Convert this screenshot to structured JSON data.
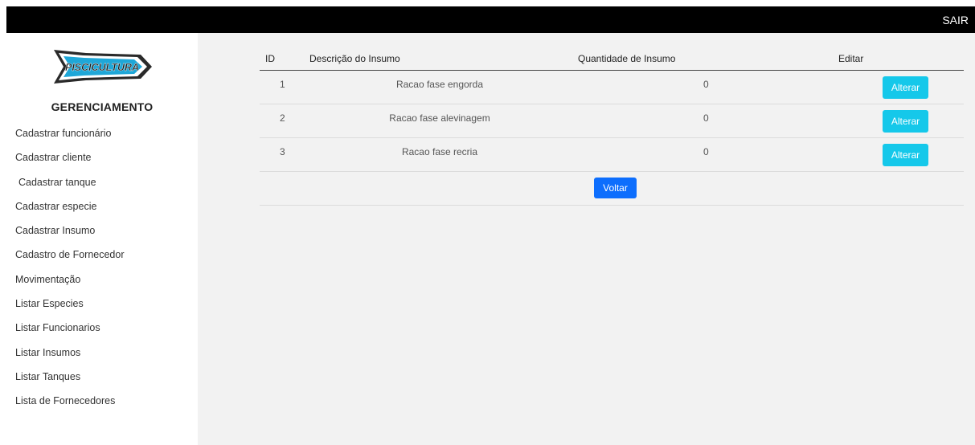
{
  "header": {
    "logout_label": "SAIR"
  },
  "sidebar": {
    "logo_text": "PISCICULTURA",
    "brand": "GERENCIAMENTO",
    "items": [
      {
        "label": "Cadastrar funcionário"
      },
      {
        "label": "Cadastrar cliente"
      },
      {
        "label": "Cadastrar tanque"
      },
      {
        "label": "Cadastrar especie"
      },
      {
        "label": "Cadastrar Insumo"
      },
      {
        "label": "Cadastro de Fornecedor"
      },
      {
        "label": "Movimentação"
      },
      {
        "label": "Listar Especies"
      },
      {
        "label": "Listar Funcionarios"
      },
      {
        "label": "Listar Insumos"
      },
      {
        "label": "Listar Tanques"
      },
      {
        "label": "Lista de Fornecedores"
      }
    ]
  },
  "table": {
    "headers": {
      "id": "ID",
      "descricao": "Descrição do Insumo",
      "quantidade": "Quantidade de Insumo",
      "editar": "Editar"
    },
    "rows": [
      {
        "id": "1",
        "descricao": "Racao fase engorda",
        "quantidade": "0",
        "action": "Alterar"
      },
      {
        "id": "2",
        "descricao": "Racao fase alevinagem",
        "quantidade": "0",
        "action": "Alterar"
      },
      {
        "id": "3",
        "descricao": "Racao fase recria",
        "quantidade": "0",
        "action": "Alterar"
      }
    ],
    "back_label": "Voltar"
  },
  "colors": {
    "topbar": "#000000",
    "alterar_button": "#15c8ea",
    "voltar_button": "#0d6efd",
    "logo_blue": "#1fa7d8"
  }
}
